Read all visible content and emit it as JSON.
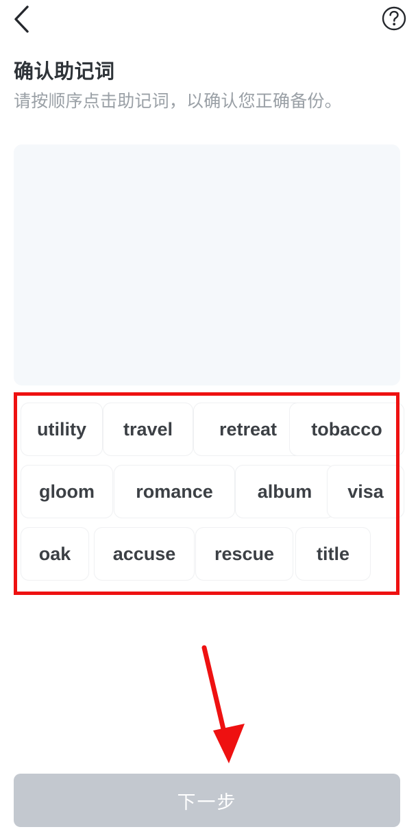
{
  "topbar": {
    "back_icon": "chevron-left-icon",
    "help_icon": "question-circle-icon"
  },
  "header": {
    "title": "确认助记词",
    "subtitle": "请按顺序点击助记词，以确认您正确备份。"
  },
  "answer_panel": {
    "selected_words": [],
    "background_color": "#f5f8fb"
  },
  "word_bank": {
    "rows": [
      [
        {
          "label": "utility"
        },
        {
          "label": "travel"
        },
        {
          "label": "retreat"
        },
        {
          "label": "tobacco"
        }
      ],
      [
        {
          "label": "gloom"
        },
        {
          "label": "romance"
        },
        {
          "label": "album"
        },
        {
          "label": "visa"
        }
      ],
      [
        {
          "label": "oak"
        },
        {
          "label": "accuse"
        },
        {
          "label": "rescue"
        },
        {
          "label": "title"
        }
      ]
    ]
  },
  "footer": {
    "next_label": "下一步",
    "next_disabled": true,
    "disabled_color": "#c3c8cf"
  },
  "annotations": {
    "highlight_color": "#ee1111",
    "box_target": "word-bank",
    "arrow_target": "next-button"
  }
}
